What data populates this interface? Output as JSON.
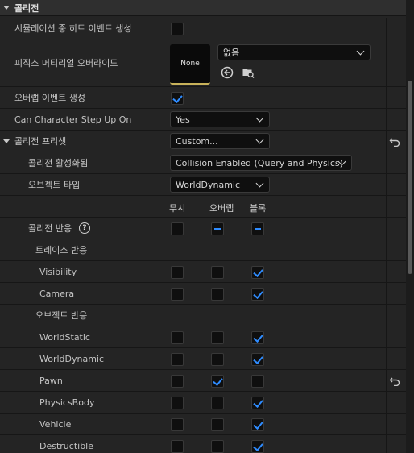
{
  "section": {
    "title": "콜리전"
  },
  "properties": {
    "sim_hit_events": {
      "label": "시뮬레이션 중 히트 이벤트 생성",
      "checked": false
    },
    "phys_material_override": {
      "label": "피직스 머티리얼 오버라이드",
      "thumb_text": "None",
      "value": "없음"
    },
    "overlap_events": {
      "label": "오버랩 이벤트 생성",
      "checked": true
    },
    "step_up": {
      "label": "Can Character Step Up On",
      "value": "Yes"
    },
    "presets": {
      "label": "콜리전 프리셋",
      "value": "Custom..."
    },
    "collision_enabled": {
      "label": "콜리전 활성화됨",
      "value": "Collision Enabled (Query and Physics)"
    },
    "object_type": {
      "label": "오브젝트 타입",
      "value": "WorldDynamic"
    }
  },
  "columns": {
    "ignore": "무시",
    "overlap": "오버랩",
    "block": "블록"
  },
  "collision_responses": {
    "label": "콜리전 반응",
    "help_glyph": "?"
  },
  "trace_responses": {
    "label": "트레이스 반응",
    "rows": [
      {
        "name": "Visibility",
        "state": "block"
      },
      {
        "name": "Camera",
        "state": "block"
      }
    ]
  },
  "object_responses": {
    "label": "오브젝트 반응",
    "rows": [
      {
        "name": "WorldStatic",
        "state": "block"
      },
      {
        "name": "WorldDynamic",
        "state": "block"
      },
      {
        "name": "Pawn",
        "state": "overlap",
        "has_reset": true
      },
      {
        "name": "PhysicsBody",
        "state": "block"
      },
      {
        "name": "Vehicle",
        "state": "block"
      },
      {
        "name": "Destructible",
        "state": "block"
      }
    ]
  },
  "colors": {
    "accent": "#2f8cff",
    "panel": "#242424",
    "field": "#0f0f0f"
  },
  "icons": [
    "arrow-left-circle-icon",
    "browse-folder-icon",
    "reset-to-default-icon",
    "chevron-down-icon"
  ]
}
